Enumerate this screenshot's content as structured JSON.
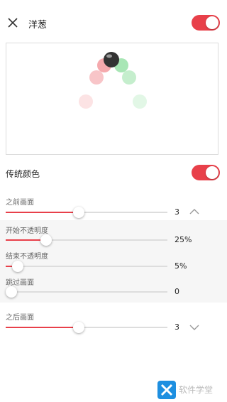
{
  "header": {
    "title": "洋葱",
    "close_icon": "close-icon",
    "toggle_on": true
  },
  "preview": {
    "balls": [
      {
        "color": "#333333",
        "opacity": 1.0
      },
      {
        "color": "#e8404a",
        "opacity": 0.45
      },
      {
        "color": "#3ec85a",
        "opacity": 0.45
      },
      {
        "color": "#e8404a",
        "opacity": 0.3
      },
      {
        "color": "#3ec85a",
        "opacity": 0.3
      },
      {
        "color": "#e8404a",
        "opacity": 0.15
      },
      {
        "color": "#3ec85a",
        "opacity": 0.15
      }
    ]
  },
  "traditional_colors": {
    "label": "传统颜色",
    "toggle_on": true
  },
  "before": {
    "label": "之前画面",
    "value": "3",
    "level": 0.45,
    "icon": "chevron-up-icon"
  },
  "start_opacity": {
    "label": "开始不透明度",
    "value": "25%",
    "level": 0.25
  },
  "end_opacity": {
    "label": "结束不透明度",
    "value": "5%",
    "level": 0.05
  },
  "skip": {
    "label": "跳过画面",
    "value": "0",
    "level": 0
  },
  "after": {
    "label": "之后画面",
    "value": "3",
    "level": 0.45,
    "icon": "chevron-down-icon"
  },
  "watermark": {
    "text": "软件学堂",
    "logo_icon": "x-logo-icon"
  },
  "colors": {
    "accent": "#e8404a",
    "track": "#dddddd"
  }
}
